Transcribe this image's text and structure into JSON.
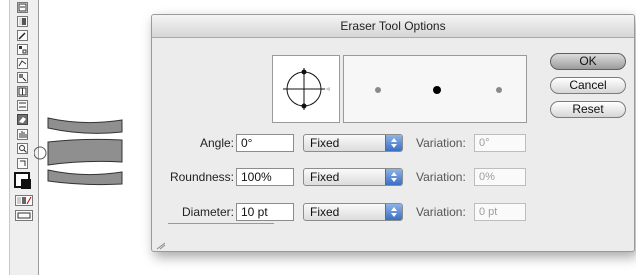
{
  "dialog": {
    "title": "Eraser Tool Options",
    "buttons": {
      "ok": "OK",
      "cancel": "Cancel",
      "reset": "Reset"
    },
    "rows": [
      {
        "label": "Angle:",
        "value": "0°",
        "mode": "Fixed",
        "variation_label": "Variation:",
        "variation_value": "0°"
      },
      {
        "label": "Roundness:",
        "value": "100%",
        "mode": "Fixed",
        "variation_label": "Variation:",
        "variation_value": "0%"
      },
      {
        "label": "Diameter:",
        "value": "10 pt",
        "mode": "Fixed",
        "variation_label": "Variation:",
        "variation_value": "0 pt"
      }
    ]
  },
  "colors": {
    "dot_light": "#8a8a8a",
    "dot_dark": "#000000",
    "primary_button": "#a6a6a6"
  },
  "toolbox": {
    "icons": [
      "type-icon",
      "gradient-icon",
      "eyedropper-icon",
      "blend-icon",
      "live-paint-icon",
      "live-paint-select-icon",
      "symbol-sprayer-icon",
      "slice-icon",
      "eraser-icon",
      "hand-icon",
      "zoom-icon",
      "swap-colors-icon",
      "fill-stroke-icon",
      "color-mode-icon",
      "screen-mode-icon"
    ]
  }
}
